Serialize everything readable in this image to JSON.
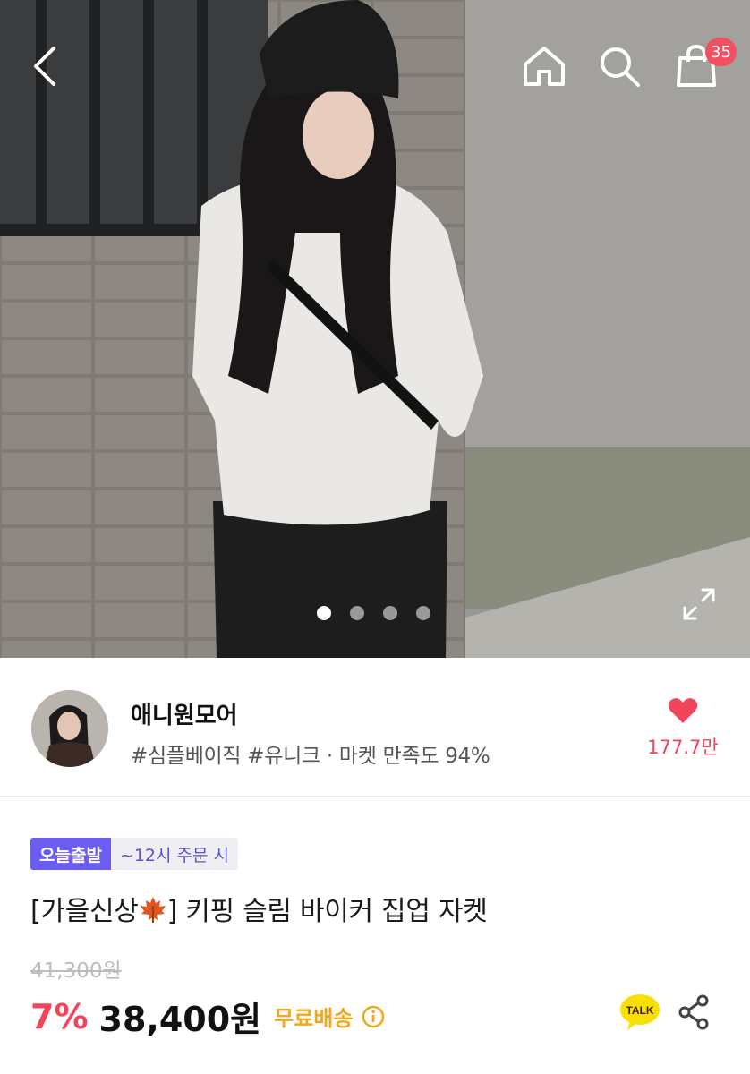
{
  "header": {
    "back_icon": "chevron-left-icon",
    "home_icon": "home-icon",
    "search_icon": "search-icon",
    "cart_icon": "shopping-bag-icon",
    "cart_count": "35"
  },
  "gallery": {
    "slide_count": 4,
    "active_index": 0,
    "expand_icon": "expand-icon"
  },
  "store": {
    "name": "애니원모어",
    "tags": "#심플베이직 #유니크 · 마켓 만족도 94%",
    "like_icon": "heart-icon",
    "like_count": "177.7만"
  },
  "product": {
    "badge_today": "오늘출발",
    "badge_order": "~12시 주문 시",
    "title_prefix": "[가을신상",
    "title_suffix": "] 키핑 슬림 바이커 집업 자켓",
    "original_price": "41,300원",
    "discount": "7%",
    "price": "38,400원",
    "shipping": "무료배송",
    "talk_label": "TALK"
  },
  "colors": {
    "accent_red": "#f0455a",
    "badge_purple": "#6b5cf2",
    "shipping_orange": "#f2a81b"
  }
}
